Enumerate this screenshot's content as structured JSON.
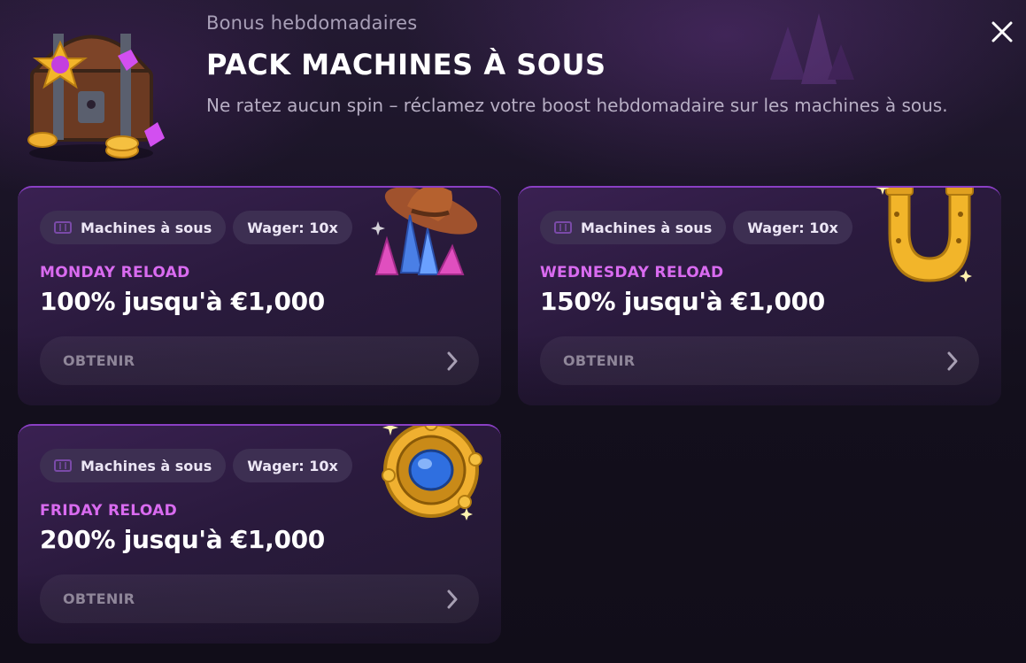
{
  "header": {
    "eyebrow": "Bonus hebdomadaires",
    "title": "PACK MACHINES À SOUS",
    "subtitle": "Ne ratez aucun spin – réclamez votre boost hebdomadaire sur les machines à sous."
  },
  "colors": {
    "accent": "#d96bf0",
    "card_border": "#8a3fc4",
    "chip_bg": "#3d2f52",
    "background": "#16111f"
  },
  "icons": {
    "close": "close-icon",
    "chest": "treasure-chest-icon",
    "slot": "slot-machine-icon",
    "chevron": "chevron-right-icon"
  },
  "cards": [
    {
      "chip_category": "Machines à sous",
      "chip_wager": "Wager: 10x",
      "label": "MONDAY RELOAD",
      "offer": "100% jusqu'à €1,000",
      "button": "OBTENIR",
      "art": "cowboy-hat-crystals-icon"
    },
    {
      "chip_category": "Machines à sous",
      "chip_wager": "Wager: 10x",
      "label": "WEDNESDAY RELOAD",
      "offer": "150% jusqu'à €1,000",
      "button": "OBTENIR",
      "art": "golden-horseshoe-icon"
    },
    {
      "chip_category": "Machines à sous",
      "chip_wager": "Wager: 10x",
      "label": "FRIDAY RELOAD",
      "offer": "200% jusqu'à €1,000",
      "button": "OBTENIR",
      "art": "sapphire-amulet-icon"
    }
  ]
}
